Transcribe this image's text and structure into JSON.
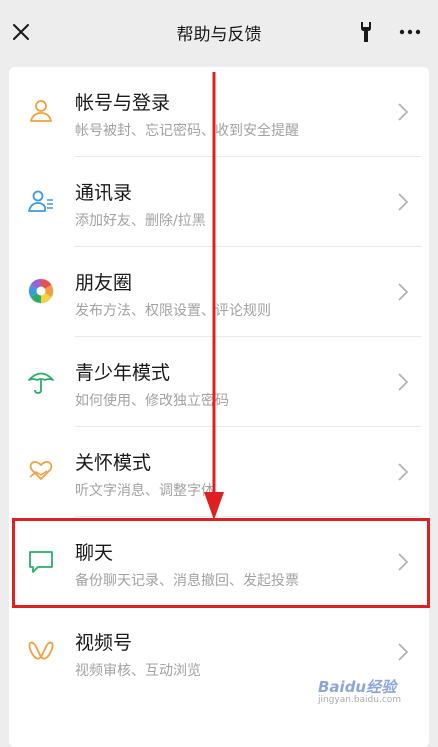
{
  "header": {
    "title": "帮助与反馈"
  },
  "items": [
    {
      "label": "帐号与登录",
      "desc": "帐号被封、忘记密码、收到安全提醒",
      "icon": "person-icon",
      "color": "#f0a040"
    },
    {
      "label": "通讯录",
      "desc": "添加好友、删除/拉黑",
      "icon": "contacts-icon",
      "color": "#3a9ae6"
    },
    {
      "label": "朋友圈",
      "desc": "发布方法、权限设置、评论规则",
      "icon": "moments-icon",
      "color": "#e85050"
    },
    {
      "label": "青少年模式",
      "desc": "如何使用、修改独立密码",
      "icon": "umbrella-icon",
      "color": "#2aae67"
    },
    {
      "label": "关怀模式",
      "desc": "听文字消息、调整字体",
      "icon": "heart-hand-icon",
      "color": "#f0a040"
    },
    {
      "label": "聊天",
      "desc": "备份聊天记录、消息撤回、发起投票",
      "icon": "chat-bubble-icon",
      "color": "#2aae67"
    },
    {
      "label": "视频号",
      "desc": "视频审核、互动浏览",
      "icon": "channels-icon",
      "color": "#f0a040"
    }
  ],
  "colors": {
    "annotation_red": "#e02020"
  },
  "watermark": {
    "text": "Baidu经验",
    "sub": "jingyan.baidu.com"
  }
}
